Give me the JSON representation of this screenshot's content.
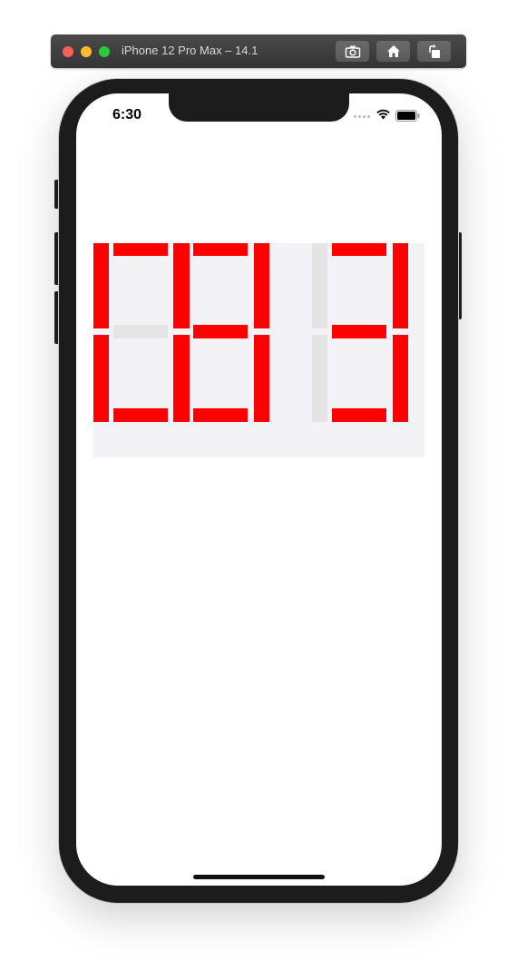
{
  "simulator": {
    "title": "iPhone 12 Pro Max – 14.1",
    "traffic_lights": {
      "close": "#fe5f57",
      "minimize": "#febc2e",
      "maximize": "#28c840"
    },
    "buttons": [
      {
        "name": "screenshot-button",
        "icon": "camera-icon"
      },
      {
        "name": "home-button",
        "icon": "home-icon"
      },
      {
        "name": "rotate-button",
        "icon": "rotate-icon"
      }
    ]
  },
  "status_bar": {
    "time": "6:30",
    "icons": [
      "signal-icon",
      "wifi-icon",
      "battery-icon"
    ]
  },
  "display": {
    "value": "083",
    "digits": [
      "0",
      "8",
      "3"
    ],
    "on_color": "#ff0000",
    "off_color": "#e4e4e4",
    "background": "#f2f2f7"
  }
}
